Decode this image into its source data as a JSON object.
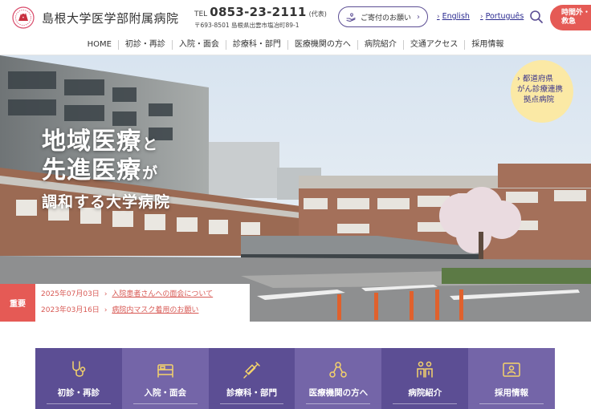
{
  "header": {
    "site_title": "島根大学医学部附属病院",
    "tel_label": "TEL",
    "tel_number": "0853-23-2111",
    "tel_note": "(代表)",
    "address": "〒693-8501 島根県出雲市塩冶町89-1",
    "donate_label": "ご寄付のお願い",
    "lang_english": "English",
    "lang_portuguese": "Português",
    "emergency_line1": "時間外・",
    "emergency_line2": "救急"
  },
  "nav": {
    "items": [
      "HOME",
      "初診・再診",
      "入院・面会",
      "診療科・部門",
      "医療機関の方へ",
      "病院紹介",
      "交通アクセス",
      "採用情報"
    ]
  },
  "hero": {
    "line1_big": "地域医療",
    "line1_small": "と",
    "line2_big": "先進医療",
    "line2_small": "が",
    "line3": "調和する大学病院",
    "badge_line1": "都道府県",
    "badge_line2": "がん診療連携",
    "badge_line3": "拠点病院"
  },
  "news": {
    "tag": "重要",
    "items": [
      {
        "date": "2025年07月03日",
        "title": "入院患者さんへの面会について"
      },
      {
        "date": "2023年03月16日",
        "title": "病院内マスク着用のお願い"
      }
    ]
  },
  "tiles": [
    {
      "label": "初診・再診",
      "icon": "stethoscope-icon"
    },
    {
      "label": "入院・面会",
      "icon": "bed-icon"
    },
    {
      "label": "診療科・部門",
      "icon": "syringe-icon"
    },
    {
      "label": "医療機関の方へ",
      "icon": "network-icon"
    },
    {
      "label": "病院紹介",
      "icon": "staff-icon"
    },
    {
      "label": "採用情報",
      "icon": "id-card-icon"
    }
  ],
  "colors": {
    "brand_purple": "#5c4e94",
    "brand_purple_light": "#7465a8",
    "alert_red": "#e55a55",
    "badge_yellow": "#fbe9a5"
  }
}
